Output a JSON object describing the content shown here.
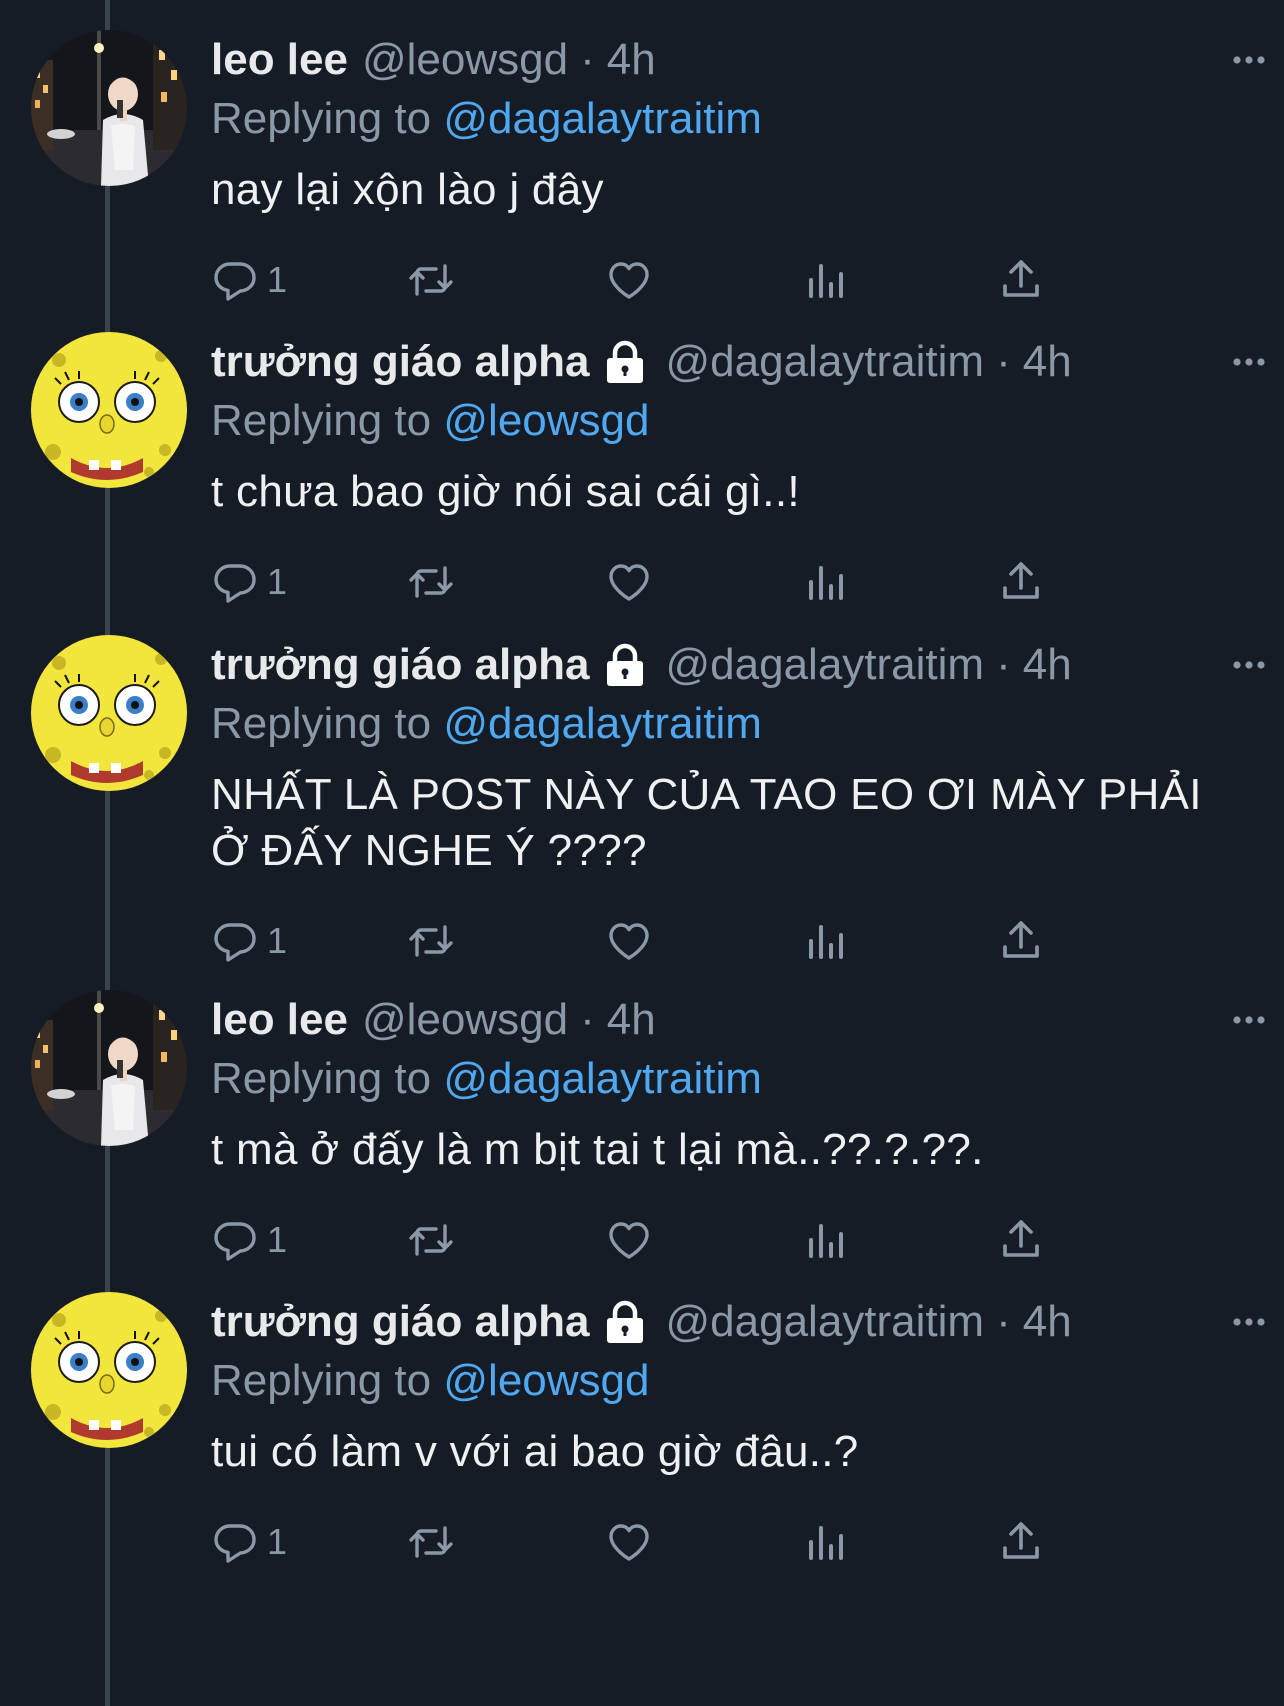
{
  "tweets": [
    {
      "user": "leo",
      "display_name": "leo lee",
      "handle": "@leowsgd",
      "locked": false,
      "time": "4h",
      "replying_label": "Replying to",
      "replying_to": "@dagalaytraitim",
      "text": "nay lại xộn lào j đây",
      "reply_count": "1"
    },
    {
      "user": "sponge",
      "display_name": "trưởng giáo alpha",
      "handle": "@dagalaytraitim",
      "locked": true,
      "time": "4h",
      "replying_label": "Replying to",
      "replying_to": "@leowsgd",
      "text": "t chưa bao giờ nói sai cái gì..!",
      "reply_count": "1"
    },
    {
      "user": "sponge",
      "display_name": "trưởng giáo alpha",
      "handle": "@dagalaytraitim",
      "locked": true,
      "time": "4h",
      "replying_label": "Replying to",
      "replying_to": "@dagalaytraitim",
      "text": "NHẤT LÀ POST NÀY CỦA TAO EO ƠI MÀY PHẢI Ở ĐẤY NGHE Ý ????",
      "reply_count": "1"
    },
    {
      "user": "leo",
      "display_name": "leo lee",
      "handle": "@leowsgd",
      "locked": false,
      "time": "4h",
      "replying_label": "Replying to",
      "replying_to": "@dagalaytraitim",
      "text": "t mà ở đấy là m bịt tai t lại mà..??.?.??.",
      "reply_count": "1"
    },
    {
      "user": "sponge",
      "display_name": "trưởng giáo alpha",
      "handle": "@dagalaytraitim",
      "locked": true,
      "time": "4h",
      "replying_label": "Replying to",
      "replying_to": "@leowsgd",
      "text": "tui có làm v với ai bao giờ đâu..?",
      "reply_count": "1"
    }
  ],
  "separator": "·",
  "colors": {
    "background": "#161c26",
    "mention": "#4fa8f0",
    "muted": "#8b98a5",
    "thread_line": "#3a444f"
  },
  "icons": {
    "reply": "reply-icon",
    "retweet": "retweet-icon",
    "like": "heart-icon",
    "views": "views-icon",
    "share": "share-icon",
    "more": "more-icon",
    "locked": "lock-icon"
  }
}
